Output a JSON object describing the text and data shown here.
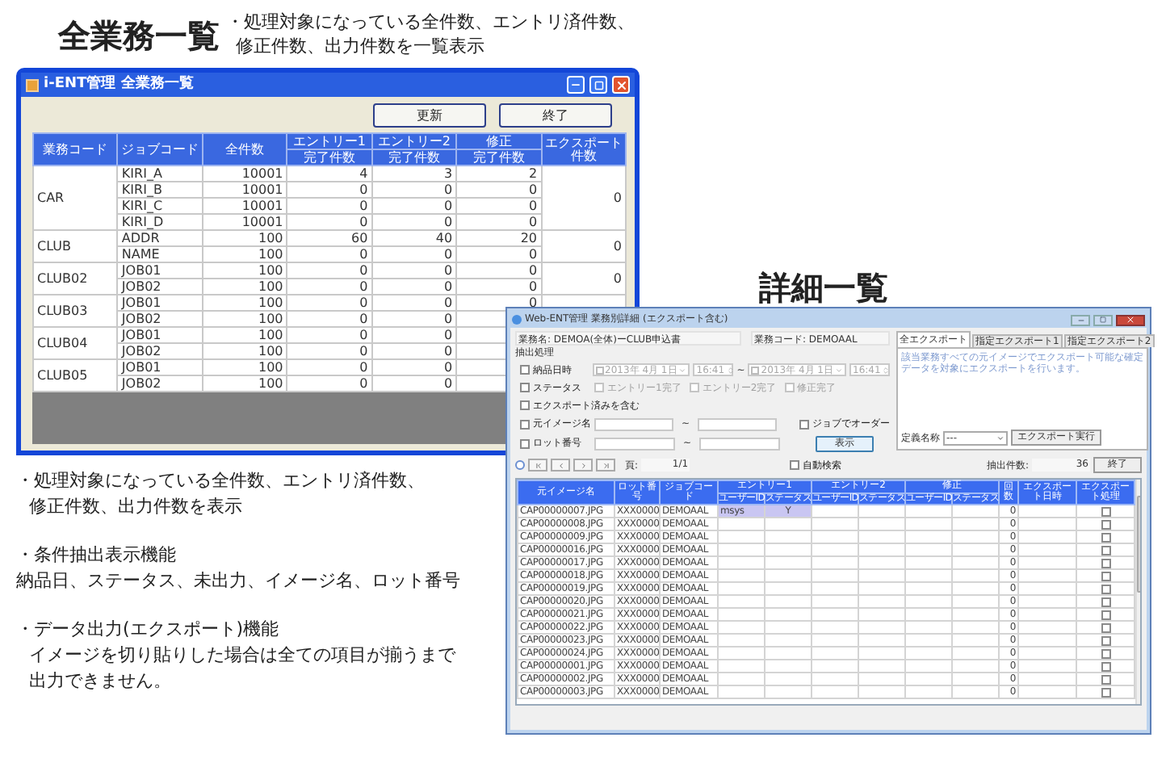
{
  "overview_heading": "全業務一覧",
  "overview_note": [
    {
      "text": "・処理対象になっている全件数、エントリ済件数、",
      "indented": false
    },
    {
      "text": "修正件数、出力件数を一覧表示",
      "indented": true
    }
  ],
  "summary_window": {
    "title": "i-ENT管理 全業務一覧",
    "buttons": [
      "更新",
      "終了"
    ],
    "columns": [
      {
        "label": "業務コード"
      },
      {
        "label": "ジョブコード"
      },
      {
        "label": "全件数"
      },
      {
        "label": "エントリー1",
        "sub": "完了件数"
      },
      {
        "label": "エントリー2",
        "sub": "完了件数"
      },
      {
        "label": "修正",
        "sub": "完了件数"
      },
      {
        "label": "エクスポート件数"
      }
    ],
    "groups": [
      {
        "code": "CAR",
        "export": "0",
        "rows": [
          {
            "job": "KIRI_A",
            "total": "10001",
            "entry1": "4",
            "entry2": "3",
            "fix": "2"
          },
          {
            "job": "KIRI_B",
            "total": "10001",
            "entry1": "0",
            "entry2": "0",
            "fix": "0"
          },
          {
            "job": "KIRI_C",
            "total": "10001",
            "entry1": "0",
            "entry2": "0",
            "fix": "0"
          },
          {
            "job": "KIRI_D",
            "total": "10001",
            "entry1": "0",
            "entry2": "0",
            "fix": "0"
          }
        ]
      },
      {
        "code": "CLUB",
        "export": "0",
        "rows": [
          {
            "job": "ADDR",
            "total": "100",
            "entry1": "60",
            "entry2": "40",
            "fix": "20"
          },
          {
            "job": "NAME",
            "total": "100",
            "entry1": "0",
            "entry2": "0",
            "fix": "0"
          }
        ]
      },
      {
        "code": "CLUB02",
        "export": "0",
        "rows": [
          {
            "job": "JOB01",
            "total": "100",
            "entry1": "0",
            "entry2": "0",
            "fix": "0"
          },
          {
            "job": "JOB02",
            "total": "100",
            "entry1": "0",
            "entry2": "0",
            "fix": "0"
          }
        ]
      },
      {
        "code": "CLUB03",
        "rows": [
          {
            "job": "JOB01",
            "total": "100",
            "entry1": "0",
            "entry2": "0",
            "fix": "0"
          },
          {
            "job": "JOB02",
            "total": "100",
            "entry1": "0",
            "entry2": "0"
          }
        ]
      },
      {
        "code": "CLUB04",
        "rows": [
          {
            "job": "JOB01",
            "total": "100",
            "entry1": "0",
            "entry2": "0"
          },
          {
            "job": "JOB02",
            "total": "100",
            "entry1": "0",
            "entry2": "0"
          }
        ]
      },
      {
        "code": "CLUB05",
        "rows": [
          {
            "job": "JOB01",
            "total": "100",
            "entry1": "0",
            "entry2": "0"
          },
          {
            "job": "JOB02",
            "total": "100",
            "entry1": "0",
            "entry2": "0"
          }
        ]
      }
    ]
  },
  "feature_notes": [
    {
      "lines": [
        {
          "text": "・処理対象になっている全件数、エントリ済件数、",
          "indented": false
        },
        {
          "text": "修正件数、出力件数を表示",
          "indented": true
        }
      ]
    },
    {
      "lines": [
        {
          "text": "・条件抽出表示機能",
          "indented": false
        },
        {
          "text": "納品日、ステータス、未出力、イメージ名、ロット番号",
          "indented": false
        }
      ]
    },
    {
      "lines": [
        {
          "text": "・データ出力(エクスポート)機能",
          "indented": false
        },
        {
          "text": "イメージを切り貼りした場合は全ての項目が揃うまで",
          "indented": true
        },
        {
          "text": "出力できません。",
          "indented": true
        }
      ]
    }
  ],
  "detail_heading": "詳細一覧",
  "detail_window": {
    "title": "Web-ENT管理 業務別詳細 (エクスポート含む)",
    "job_name": "業務名: DEMOA(全体)ーCLUB申込書",
    "job_code": "業務コード: DEMOAAL",
    "filter": {
      "label": "抽出処理",
      "delivery": {
        "label": "納品日時",
        "checked": false,
        "from_date": "2013年 4月 1日",
        "from_time": "16:41",
        "separator": "~",
        "to_date": "2013年 4月 1日",
        "to_time": "16:41"
      },
      "status": {
        "label": "ステータス",
        "checked": false,
        "options": [
          {
            "label": "エントリー1完了",
            "checked": false
          },
          {
            "label": "エントリー2完了",
            "checked": false
          },
          {
            "label": "修正完了",
            "checked": false
          }
        ]
      },
      "include_exported": {
        "label": "エクスポート済みを含む",
        "checked": false
      },
      "image_name": {
        "label": "元イメージ名",
        "checked": false,
        "separator": "~"
      },
      "lot_number": {
        "label": "ロット番号",
        "checked": false,
        "separator": "~"
      },
      "order_by_job": {
        "label": "ジョブでオーダー",
        "checked": false
      },
      "show_button": "表示"
    },
    "tabs": [
      {
        "label": "全エクスポート",
        "selected": true
      },
      {
        "label": "指定エクスポート1",
        "selected": false
      },
      {
        "label": "指定エクスポート2",
        "selected": false
      }
    ],
    "tab_description": "該当業務すべての元イメージでエクスポート可能な確定データを対象にエクスポートを行います。",
    "definition_label": "定義名称",
    "definition_value": "---",
    "export_button": "エクスポート実行",
    "pager": {
      "page_label": "頁:",
      "page": "1/1",
      "auto_search": {
        "label": "自動検索",
        "checked": false
      },
      "count_label": "抽出件数:",
      "count": "36",
      "close_button": "終了"
    },
    "table": {
      "columns": [
        {
          "label": "元イメージ名"
        },
        {
          "label": "ロット番号"
        },
        {
          "label": "ジョブコード"
        },
        {
          "label": "エントリー1",
          "subs": [
            "ユーザーID",
            "ステータス"
          ]
        },
        {
          "label": "エントリー2",
          "subs": [
            "ユーザーID",
            "ステータス"
          ]
        },
        {
          "label": "修正",
          "subs": [
            "ユーザーID",
            "ステータス"
          ]
        },
        {
          "label": "回数"
        },
        {
          "label": "エクスポート日時"
        },
        {
          "label": "エクスポート処理"
        }
      ],
      "rows": [
        {
          "image": "CAP00000007.JPG",
          "lot": "XXX0000",
          "job": "DEMOAAL",
          "entry1_user": "msys",
          "entry1_status": "Y",
          "count": "0",
          "export_checked": false,
          "selected": true
        },
        {
          "image": "CAP00000008.JPG",
          "lot": "XXX0000",
          "job": "DEMOAAL",
          "count": "0",
          "export_checked": false,
          "selected": false
        },
        {
          "image": "CAP00000009.JPG",
          "lot": "XXX0000",
          "job": "DEMOAAL",
          "count": "0",
          "export_checked": false,
          "selected": false
        },
        {
          "image": "CAP00000016.JPG",
          "lot": "XXX0000",
          "job": "DEMOAAL",
          "count": "0",
          "export_checked": false,
          "selected": false
        },
        {
          "image": "CAP00000017.JPG",
          "lot": "XXX0000",
          "job": "DEMOAAL",
          "count": "0",
          "export_checked": false,
          "selected": false
        },
        {
          "image": "CAP00000018.JPG",
          "lot": "XXX0000",
          "job": "DEMOAAL",
          "count": "0",
          "export_checked": false,
          "selected": false
        },
        {
          "image": "CAP00000019.JPG",
          "lot": "XXX0000",
          "job": "DEMOAAL",
          "count": "0",
          "export_checked": false,
          "selected": false
        },
        {
          "image": "CAP00000020.JPG",
          "lot": "XXX0000",
          "job": "DEMOAAL",
          "count": "0",
          "export_checked": false,
          "selected": false
        },
        {
          "image": "CAP00000021.JPG",
          "lot": "XXX0000",
          "job": "DEMOAAL",
          "count": "0",
          "export_checked": false,
          "selected": false
        },
        {
          "image": "CAP00000022.JPG",
          "lot": "XXX0000",
          "job": "DEMOAAL",
          "count": "0",
          "export_checked": false,
          "selected": false
        },
        {
          "image": "CAP00000023.JPG",
          "lot": "XXX0000",
          "job": "DEMOAAL",
          "count": "0",
          "export_checked": false,
          "selected": false
        },
        {
          "image": "CAP00000024.JPG",
          "lot": "XXX0000",
          "job": "DEMOAAL",
          "count": "0",
          "export_checked": false,
          "selected": false
        },
        {
          "image": "CAP00000001.JPG",
          "lot": "XXX0000",
          "job": "DEMOAAL",
          "count": "0",
          "export_checked": false,
          "selected": false
        },
        {
          "image": "CAP00000002.JPG",
          "lot": "XXX0000",
          "job": "DEMOAAL",
          "count": "0",
          "export_checked": false,
          "selected": false
        },
        {
          "image": "CAP00000003.JPG",
          "lot": "XXX0000",
          "job": "DEMOAAL",
          "count": "0",
          "export_checked": false,
          "selected": false
        }
      ]
    }
  }
}
